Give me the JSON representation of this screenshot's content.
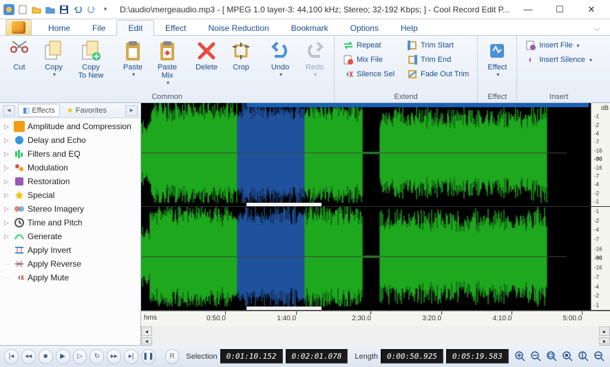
{
  "title": "D:\\audio\\mergeaudio.mp3 - [ MPEG 1.0 layer-3: 44,100 kHz; Stereo; 32-192 Kbps;  ] - Cool Record Edit P...",
  "tabs": [
    "Home",
    "File",
    "Edit",
    "Effect",
    "Noise Reduction",
    "Bookmark",
    "Options",
    "Help"
  ],
  "active_tab": "Edit",
  "ribbon": {
    "common": {
      "label": "Common",
      "cut": "Cut",
      "copy": "Copy",
      "copy_new": "Copy\nTo New",
      "paste": "Paste",
      "paste_mix": "Paste\nMix",
      "delete": "Delete",
      "crop": "Crop",
      "undo": "Undo",
      "redo": "Redo"
    },
    "extend": {
      "label": "Extend",
      "repeat": "Repeat",
      "mix_file": "Mix File",
      "silence_sel": "Silence Sel",
      "trim_start": "Trim Start",
      "trim_end": "Trim End",
      "fade_out_trim": "Fade Out Trim"
    },
    "effect": {
      "label": "Effect",
      "effect": "Effect"
    },
    "insert": {
      "label": "Insert",
      "insert_file": "Insert File",
      "insert_silence": "Insert Silence"
    }
  },
  "sidebar": {
    "tabs": {
      "effects": "Effects",
      "favorites": "Favorites"
    },
    "items": [
      "Amplitude and Compression",
      "Delay and Echo",
      "Filters and EQ",
      "Modulation",
      "Restoration",
      "Special",
      "Stereo Imagery",
      "Time and Pitch",
      "Generate",
      "Apply Invert",
      "Apply Reverse",
      "Apply Mute"
    ]
  },
  "db_label": "dB",
  "db_ticks": [
    "-1",
    "-2",
    "-4",
    "-7",
    "-16",
    "-90",
    "-16",
    "-7",
    "-4",
    "-2",
    "-1"
  ],
  "timeline": {
    "unit": "hms",
    "ticks": [
      "0:50.0",
      "1:40.0",
      "2:30.0",
      "3:20.0",
      "4:10.0",
      "5:00.0"
    ]
  },
  "status": {
    "selection_label": "Selection",
    "sel_start": "0:01:10.152",
    "sel_end": "0:02:01.078",
    "length_label": "Length",
    "len1": "0:00:50.925",
    "len2": "0:05:19.583"
  },
  "colors": {
    "wave_primary": "#28e028",
    "wave_selected": "#2a6fd0",
    "bg": "#000000"
  }
}
